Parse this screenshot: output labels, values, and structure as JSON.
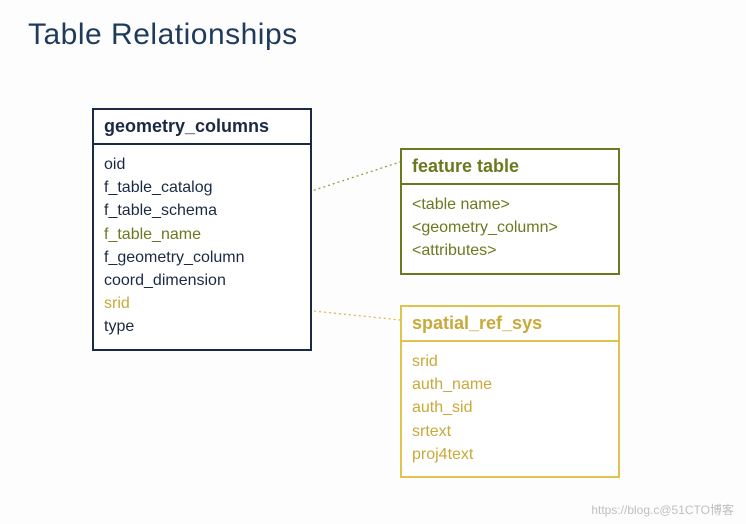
{
  "title": "Table Relationships",
  "tables": {
    "geometry_columns": {
      "name": "geometry_columns",
      "fields": [
        {
          "label": "oid",
          "link": null
        },
        {
          "label": "f_table_catalog",
          "link": null
        },
        {
          "label": "f_table_schema",
          "link": null
        },
        {
          "label": "f_table_name",
          "link": "feature_table"
        },
        {
          "label": "f_geometry_column",
          "link": null
        },
        {
          "label": "coord_dimension",
          "link": null
        },
        {
          "label": "srid",
          "link": "spatial_ref_sys"
        },
        {
          "label": "type",
          "link": null
        }
      ]
    },
    "feature_table": {
      "name": "feature table",
      "fields": [
        {
          "label": "<table name>",
          "link": null
        },
        {
          "label": "<geometry_column>",
          "link": null
        },
        {
          "label": "<attributes>",
          "link": null
        }
      ]
    },
    "spatial_ref_sys": {
      "name": "spatial_ref_sys",
      "fields": [
        {
          "label": "srid",
          "link": null
        },
        {
          "label": "auth_name",
          "link": null
        },
        {
          "label": "auth_sid",
          "link": null
        },
        {
          "label": "srtext",
          "link": null
        },
        {
          "label": "proj4text",
          "link": null
        }
      ]
    }
  },
  "relationships": [
    {
      "from_table": "geometry_columns",
      "from_field": "f_table_name",
      "to_table": "feature_table",
      "to_field": "<table name>",
      "color": "#8a9a2f"
    },
    {
      "from_table": "geometry_columns",
      "from_field": "srid",
      "to_table": "spatial_ref_sys",
      "to_field": "srid",
      "color": "#d6b93f"
    }
  ],
  "watermark": "https://blog.c@51CTO博客"
}
